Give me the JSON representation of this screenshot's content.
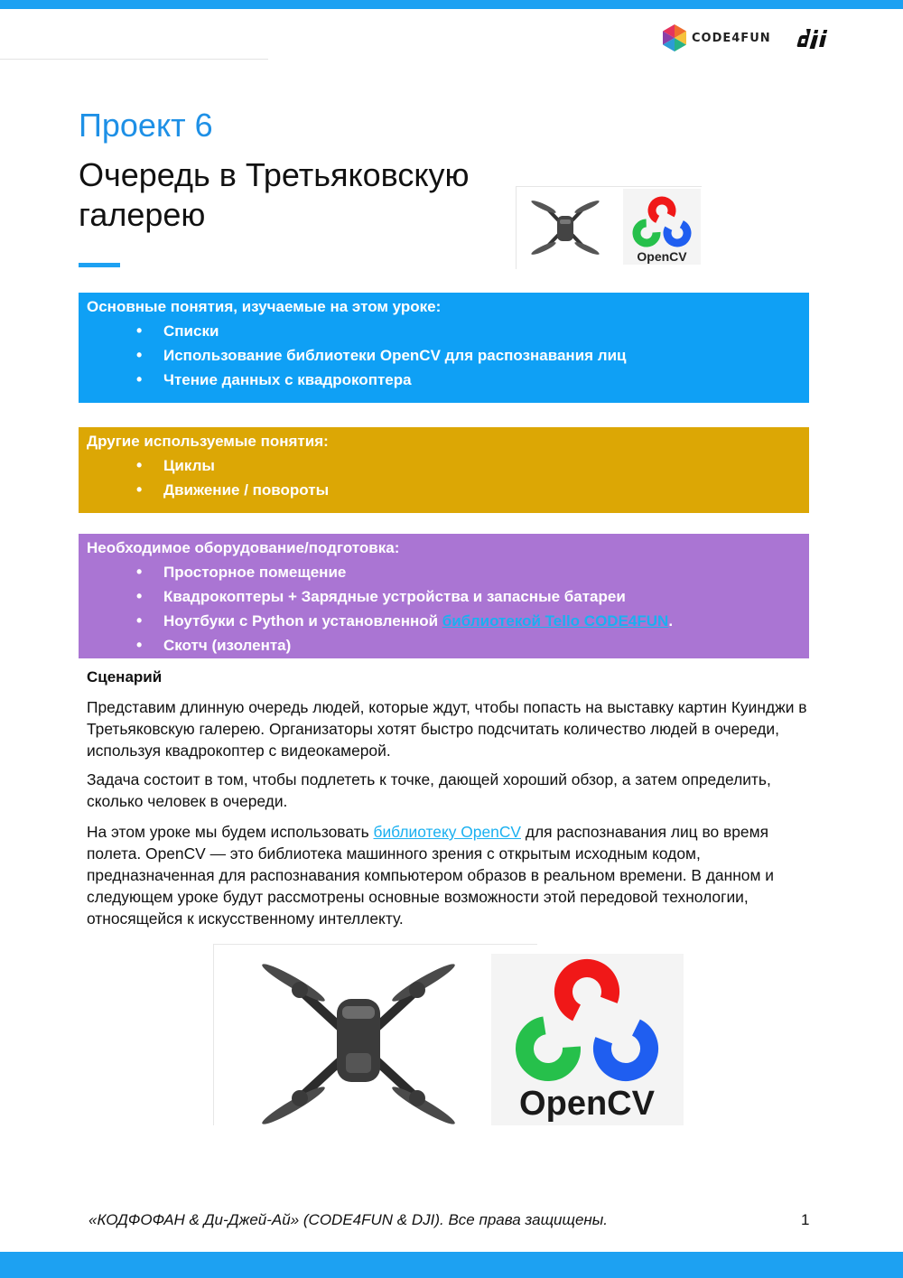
{
  "header": {
    "brand_code4fun": "CODE4FUN",
    "brand_dji": "dji"
  },
  "project": {
    "label": "Проект 6",
    "title": "Очередь в Третьяковскую галерею"
  },
  "thumbs": {
    "opencv_caption": "OpenCV"
  },
  "concepts_box": {
    "title": "Основные понятия, изучаемые на этом уроке:",
    "items": [
      "Списки",
      "Использование библиотеки OpenCV для распознавания лиц",
      "Чтение данных с квадрокоптера"
    ],
    "color": "#0fa0f5"
  },
  "other_box": {
    "title": "Другие используемые понятия:",
    "items": [
      "Циклы",
      "Движение / повороты"
    ],
    "color": "#dca705"
  },
  "equipment_box": {
    "title": "Необходимое оборудование/подготовка:",
    "items": [
      "Просторное помещение",
      "Квадрокоптеры + Зарядные устройства и запасные батареи"
    ],
    "laptops_prefix": "Ноутбуки с Python и установленной ",
    "laptops_link": "библиотекой Tello CODE4FUN",
    "laptops_suffix": ".",
    "tape": "Скотч (изолента)",
    "color": "#aa75d3"
  },
  "scenario": {
    "heading": "Сценарий",
    "p1": "Представим длинную очередь людей, которые ждут, чтобы попасть на выставку картин Куинджи в Третьяковскую галерею. Организаторы хотят быстро подсчитать количество людей в очереди, используя квадрокоптер с видеокамерой.",
    "p2": "Задача состоит в том, чтобы подлететь к точке, дающей хороший обзор, а затем определить, сколько человек в очереди.",
    "p3_prefix": "На этом уроке мы будем использовать ",
    "p3_link": "библиотеку OpenCV",
    "p3_suffix": " для распознавания лиц во время полета. OpenCV — это библиотека машинного зрения с открытым исходным кодом, предназначенная для распознавания компьютером образов в реальном времени. В данном и следующем уроке будут рассмотрены основные возможности этой передовой технологии, относящейся к искусственному интеллекту."
  },
  "images": {
    "opencv_caption": "OpenCV"
  },
  "footer": {
    "text": "«КОДФОФАН & Ди-Джей-Ай» (CODE4FUN & DJI). Все права защищены.",
    "page": "1"
  }
}
